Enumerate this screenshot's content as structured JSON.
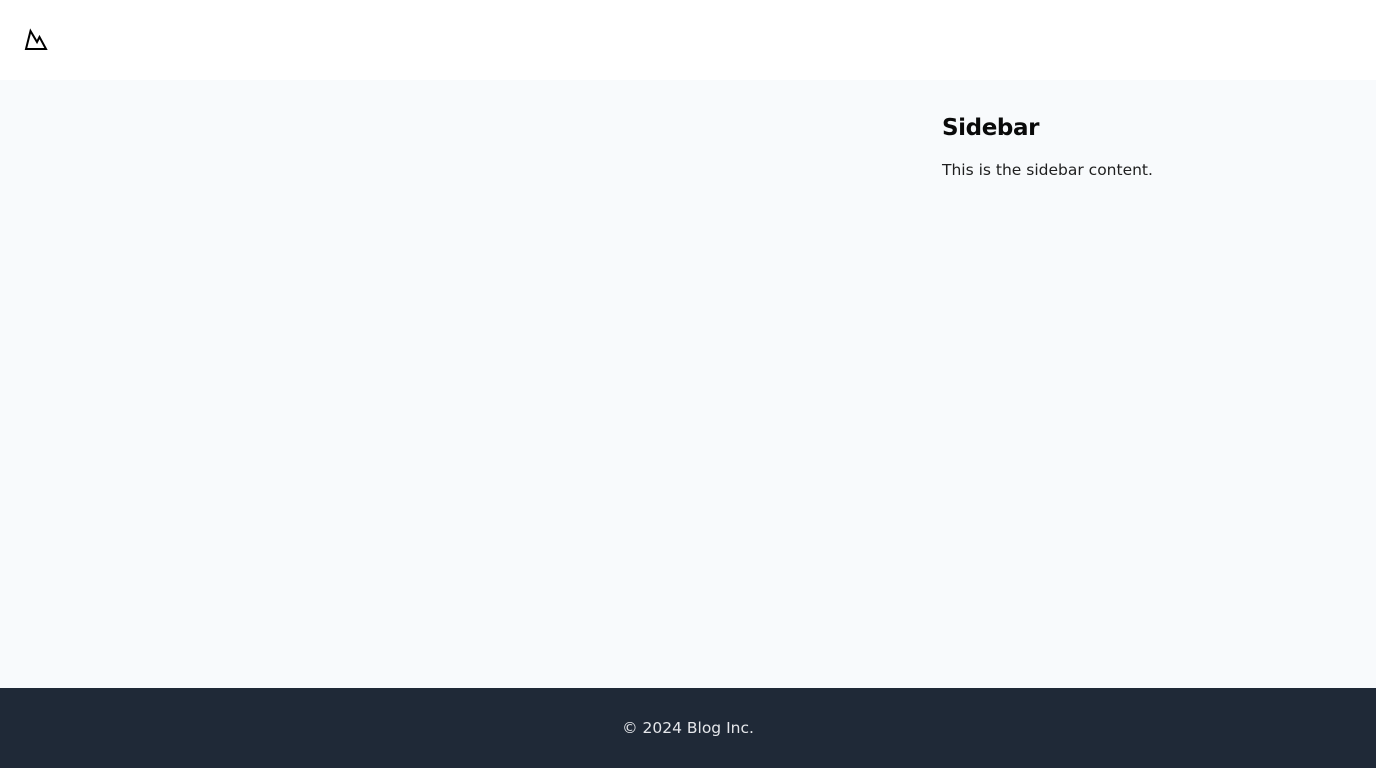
{
  "header": {
    "logo_icon": "mountain-icon"
  },
  "sidebar": {
    "title": "Sidebar",
    "text": "This is the sidebar content."
  },
  "footer": {
    "copyright": "© 2024 Blog Inc."
  },
  "colors": {
    "header_bg": "#ffffff",
    "main_bg": "#f8fafc",
    "footer_bg": "#1f2937",
    "footer_text": "#e5e7eb",
    "heading_text": "#0a0a0a"
  }
}
